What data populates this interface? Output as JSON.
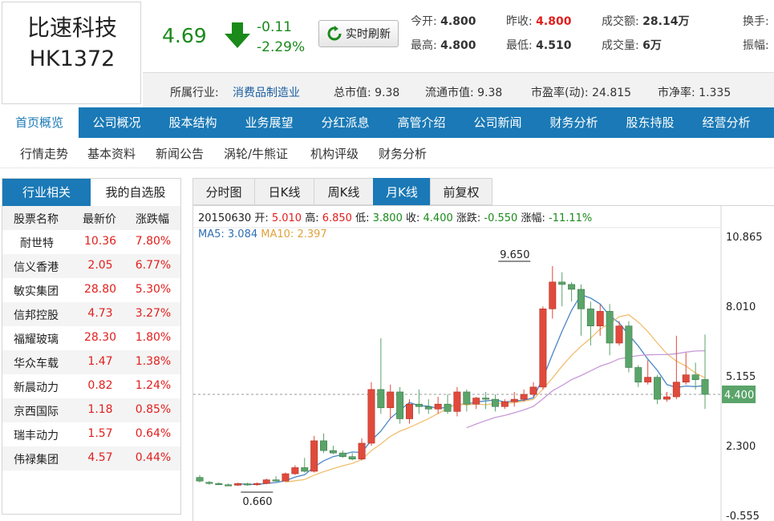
{
  "stock": {
    "name": "比速科技",
    "code": "HK1372"
  },
  "quote": {
    "price": "4.69",
    "change": "-0.11",
    "change_pct": "-2.29%",
    "refresh_label": "实时刷新",
    "fields": [
      {
        "label": "今开:",
        "value": "4.800",
        "red": false
      },
      {
        "label": "昨收:",
        "value": "4.800",
        "red": true
      },
      {
        "label": "成交额:",
        "value": "28.14万",
        "red": false
      },
      {
        "label": "换手:",
        "value": "",
        "red": false
      },
      {
        "label": "最高:",
        "value": "4.800",
        "red": false
      },
      {
        "label": "最低:",
        "value": "4.510",
        "red": false
      },
      {
        "label": "成交量:",
        "value": "6万",
        "red": false
      },
      {
        "label": "振幅:",
        "value": "",
        "red": false
      }
    ]
  },
  "info": {
    "industry_label": "所属行业:",
    "industry_value": "消费品制造业",
    "mcap_label": "总市值:",
    "mcap_value": "9.38",
    "float_label": "流通市值:",
    "float_value": "9.38",
    "pe_label": "市盈率(动):",
    "pe_value": "24.815",
    "pb_label": "市净率:",
    "pb_value": "1.335"
  },
  "nav_main": [
    "首页概览",
    "公司概况",
    "股本结构",
    "业务展望",
    "分红派息",
    "高管介绍",
    "公司新闻",
    "财务分析",
    "股东持股",
    "经营分析"
  ],
  "nav_sub": [
    "行情走势",
    "基本资料",
    "新闻公告",
    "涡轮/牛熊证",
    "机构评级",
    "财务分析"
  ],
  "left_panel": {
    "tabs": [
      "行业相关",
      "我的自选股"
    ],
    "headers": [
      "股票名称",
      "最新价",
      "涨跌幅"
    ],
    "rows": [
      {
        "name": "耐世特",
        "price": "10.36",
        "pct": "7.80%"
      },
      {
        "name": "信义香港",
        "price": "2.05",
        "pct": "6.77%"
      },
      {
        "name": "敏实集团",
        "price": "28.80",
        "pct": "5.30%"
      },
      {
        "name": "信邦控股",
        "price": "4.73",
        "pct": "3.27%"
      },
      {
        "name": "福耀玻璃",
        "price": "28.30",
        "pct": "1.80%"
      },
      {
        "name": "华众车载",
        "price": "1.47",
        "pct": "1.38%"
      },
      {
        "name": "新晨动力",
        "price": "0.82",
        "pct": "1.24%"
      },
      {
        "name": "京西国际",
        "price": "1.18",
        "pct": "0.85%"
      },
      {
        "name": "瑞丰动力",
        "price": "1.57",
        "pct": "0.64%"
      },
      {
        "name": "伟禄集团",
        "price": "4.57",
        "pct": "0.44%"
      }
    ]
  },
  "chart_tabs": [
    "分时图",
    "日K线",
    "周K线",
    "月K线",
    "前复权"
  ],
  "chart_info": {
    "date": "20150630",
    "open_label": "开:",
    "open": "5.010",
    "high_label": "高:",
    "high": "6.850",
    "low_label": "低:",
    "low": "3.800",
    "close_label": "收:",
    "close": "4.400",
    "chg_label": "涨跌:",
    "chg": "-0.550",
    "pct_label": "涨幅:",
    "pct": "-11.11%",
    "ma5_label": "MA5:",
    "ma5": "3.084",
    "ma10_label": "MA10:",
    "ma10": "2.397"
  },
  "chart_data": {
    "type": "candlestick",
    "y_ticks": [
      "10.865",
      "8.010",
      "5.155",
      "2.300",
      "-0.555"
    ],
    "ylim": [
      -0.555,
      10.865
    ],
    "current_price_label": "4.400",
    "current_price": 4.4,
    "annotations": {
      "max": "9.650",
      "min": "0.660",
      "max_value": 9.65,
      "min_value": 0.66,
      "max_index": 33,
      "min_index": 6
    },
    "candles": [
      [
        1.0,
        1.1,
        0.85,
        0.8
      ],
      [
        0.8,
        0.85,
        0.75,
        0.7
      ],
      [
        0.75,
        0.8,
        0.7,
        0.7
      ],
      [
        0.7,
        0.75,
        0.67,
        0.66
      ],
      [
        0.68,
        0.78,
        0.75,
        0.65
      ],
      [
        0.74,
        0.78,
        0.7,
        0.66
      ],
      [
        0.7,
        0.8,
        0.75,
        0.66
      ],
      [
        0.75,
        0.95,
        0.9,
        0.72
      ],
      [
        0.9,
        1.05,
        0.85,
        0.82
      ],
      [
        0.85,
        1.2,
        1.15,
        0.82
      ],
      [
        1.15,
        1.5,
        1.4,
        1.1
      ],
      [
        1.4,
        1.8,
        1.25,
        1.2
      ],
      [
        1.25,
        2.7,
        2.5,
        1.2
      ],
      [
        2.5,
        2.8,
        2.1,
        2.0
      ],
      [
        2.1,
        2.3,
        2.0,
        1.95
      ],
      [
        2.0,
        2.1,
        1.85,
        1.8
      ],
      [
        1.85,
        2.0,
        1.75,
        1.7
      ],
      [
        1.75,
        2.6,
        2.4,
        1.7
      ],
      [
        2.4,
        4.9,
        4.6,
        2.3
      ],
      [
        4.6,
        6.7,
        3.85,
        3.6
      ],
      [
        3.85,
        4.8,
        4.5,
        3.4
      ],
      [
        4.5,
        4.7,
        3.4,
        3.2
      ],
      [
        3.4,
        4.2,
        4.0,
        3.2
      ],
      [
        4.0,
        4.6,
        3.9,
        3.6
      ],
      [
        3.9,
        4.2,
        3.8,
        3.6
      ],
      [
        3.8,
        4.3,
        4.0,
        3.6
      ],
      [
        4.0,
        4.4,
        3.7,
        3.6
      ],
      [
        3.7,
        4.7,
        4.5,
        3.5
      ],
      [
        4.5,
        4.6,
        4.0,
        3.7
      ],
      [
        4.0,
        4.3,
        4.25,
        3.8
      ],
      [
        4.25,
        4.5,
        4.2,
        3.8
      ],
      [
        4.2,
        4.4,
        3.9,
        3.7
      ],
      [
        3.9,
        4.2,
        4.1,
        3.8
      ],
      [
        4.1,
        4.5,
        4.2,
        3.9
      ],
      [
        4.2,
        4.6,
        4.4,
        4.1
      ],
      [
        4.4,
        4.9,
        4.7,
        4.3
      ],
      [
        4.7,
        8.0,
        7.9,
        4.6
      ],
      [
        7.9,
        9.65,
        9.0,
        7.5
      ],
      [
        9.0,
        9.4,
        8.9,
        8.0
      ],
      [
        8.9,
        9.0,
        8.7,
        8.2
      ],
      [
        8.7,
        8.9,
        7.9,
        6.8
      ],
      [
        7.9,
        8.2,
        7.2,
        6.4
      ],
      [
        7.2,
        8.1,
        7.8,
        6.8
      ],
      [
        7.8,
        8.1,
        6.5,
        6.0
      ],
      [
        6.5,
        7.4,
        7.2,
        6.4
      ],
      [
        7.2,
        7.4,
        5.5,
        5.3
      ],
      [
        5.5,
        5.6,
        4.9,
        4.7
      ],
      [
        4.9,
        5.8,
        5.1,
        4.8
      ],
      [
        5.1,
        5.2,
        4.2,
        4.0
      ],
      [
        4.2,
        4.5,
        4.3,
        4.1
      ],
      [
        4.3,
        6.8,
        4.9,
        4.2
      ],
      [
        4.9,
        6.1,
        5.2,
        4.8
      ],
      [
        5.2,
        5.7,
        5.0,
        4.6
      ],
      [
        5.01,
        6.85,
        4.4,
        3.8
      ]
    ]
  }
}
